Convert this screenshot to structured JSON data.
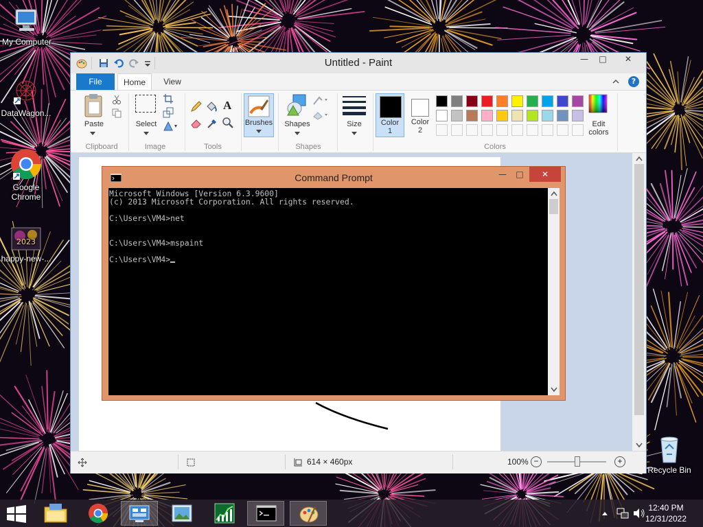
{
  "desktop": {
    "icons": [
      {
        "label": "My Computer"
      },
      {
        "label": "DataWagon..."
      },
      {
        "label": "Google Chrome"
      },
      {
        "label": "happy-new-..."
      },
      {
        "label": "Recycle Bin"
      }
    ],
    "happy_icon_text": "2023"
  },
  "paint": {
    "title": "Untitled - Paint",
    "tabs": {
      "file": "File",
      "home": "Home",
      "view": "View"
    },
    "clipboard": {
      "paste": "Paste",
      "label": "Clipboard"
    },
    "image": {
      "select": "Select",
      "label": "Image"
    },
    "tools": {
      "label": "Tools"
    },
    "brushes": {
      "label": "Brushes"
    },
    "shapes": {
      "button": "Shapes",
      "label": "Shapes"
    },
    "size": {
      "label": "Size"
    },
    "color1": {
      "line1": "Color",
      "line2": "1"
    },
    "color2": {
      "line1": "Color",
      "line2": "2"
    },
    "colors_label": "Colors",
    "edit_colors": {
      "line1": "Edit",
      "line2": "colors"
    },
    "palette_row1": [
      "#000000",
      "#7f7f7f",
      "#880015",
      "#ed1c24",
      "#ff7f27",
      "#fff200",
      "#22b14c",
      "#00a2e8",
      "#3f48cc",
      "#a349a4"
    ],
    "palette_row2": [
      "#ffffff",
      "#c3c3c3",
      "#b97a57",
      "#ffaec9",
      "#ffc90e",
      "#efe4b0",
      "#b5e61d",
      "#99d9ea",
      "#7092be",
      "#c8bfe7"
    ],
    "status": {
      "dimensions": "614 × 460px",
      "zoom": "100%"
    }
  },
  "cmd": {
    "title": "Command Prompt",
    "lines": [
      "Microsoft Windows [Version 6.3.9600]",
      "(c) 2013 Microsoft Corporation. All rights reserved.",
      "C:\\Users\\VM4>net",
      "C:\\Users\\VM4>mspaint",
      "C:\\Users\\VM4>"
    ]
  },
  "taskbar": {
    "time": "12:40 PM",
    "date": "12/31/2022"
  },
  "icons": {
    "help": "?",
    "minimize": "—",
    "maximize": "□",
    "close": "✕",
    "zoom_out": "−",
    "zoom_in": "+"
  }
}
